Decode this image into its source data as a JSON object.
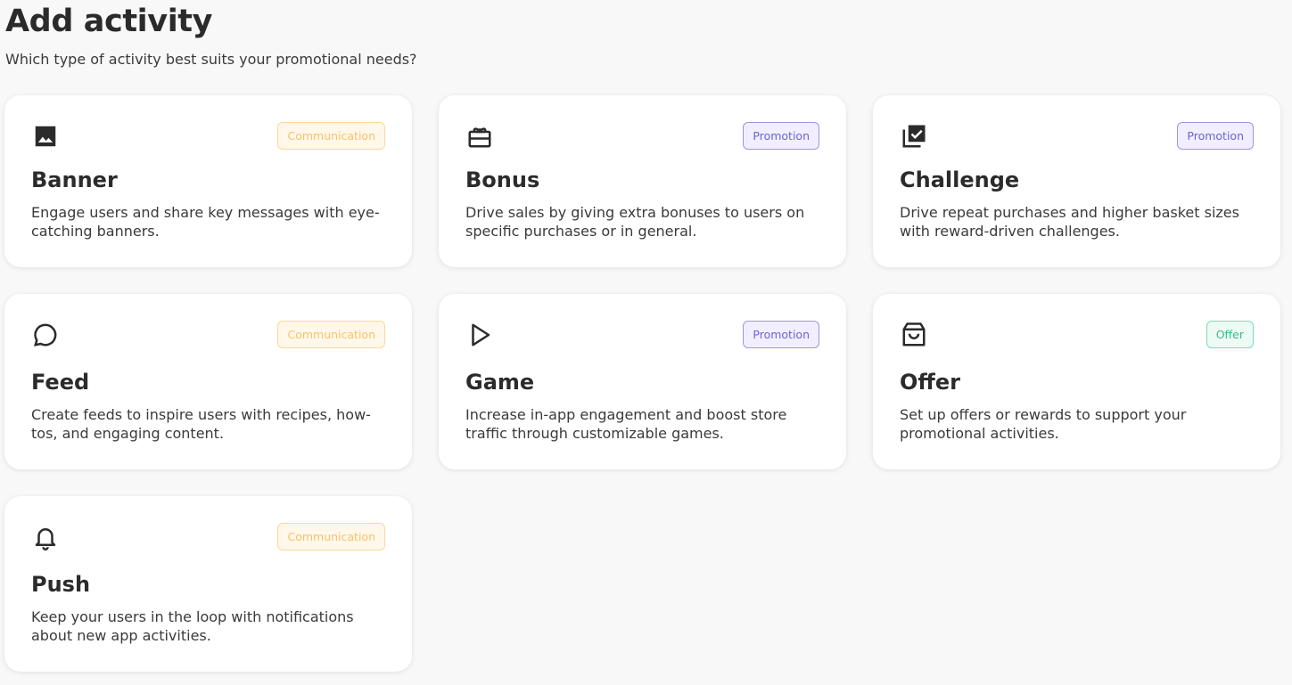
{
  "header": {
    "title": "Add activity",
    "subtitle": "Which type of activity best suits your promotional needs?"
  },
  "colors": {
    "communication": "#f6c26a",
    "promotion": "#6d63d6",
    "offer": "#2fbf8a"
  },
  "cards": [
    {
      "icon": "image-icon",
      "badge": "Communication",
      "title": "Banner",
      "description": "Engage users and share key messages with eye-catching banners."
    },
    {
      "icon": "gift-card-icon",
      "badge": "Promotion",
      "title": "Bonus",
      "description": "Drive sales by giving extra bonuses to users on specific purchases or in general."
    },
    {
      "icon": "library-check-icon",
      "badge": "Promotion",
      "title": "Challenge",
      "description": "Drive repeat purchases and higher basket sizes with reward-driven challenges."
    },
    {
      "icon": "chat-bubble-icon",
      "badge": "Communication",
      "title": "Feed",
      "description": "Create feeds to inspire users with recipes, how-tos, and engaging content."
    },
    {
      "icon": "play-icon",
      "badge": "Promotion",
      "title": "Game",
      "description": "Increase in-app engagement and boost store traffic through customizable games."
    },
    {
      "icon": "shopping-bag-icon",
      "badge": "Offer",
      "title": "Offer",
      "description": "Set up offers or rewards to support your promotional activities."
    },
    {
      "icon": "bell-icon",
      "badge": "Communication",
      "title": "Push",
      "description": "Keep your users in the loop with notifications about new app activities."
    }
  ]
}
